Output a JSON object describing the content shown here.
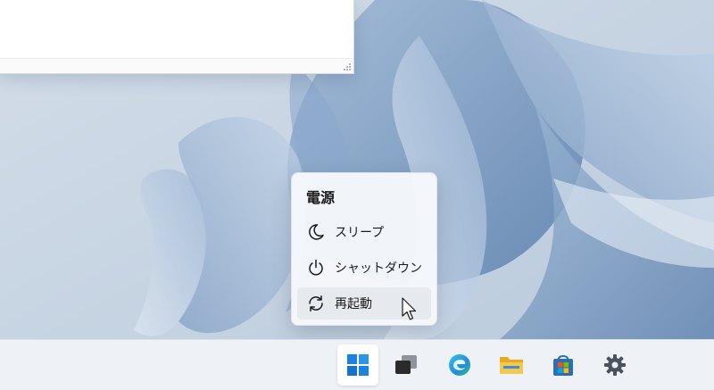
{
  "desktop": {
    "wallpaper": "windows-11-bloom-light"
  },
  "power_menu": {
    "title": "電源",
    "items": [
      {
        "label": "スリープ",
        "icon": "moon-icon"
      },
      {
        "label": "シャットダウン",
        "icon": "power-icon"
      },
      {
        "label": "再起動",
        "icon": "restart-icon"
      }
    ]
  },
  "taskbar": {
    "icons": [
      {
        "name": "windows-start-icon",
        "color": "#1a82e0"
      },
      {
        "name": "task-view-icon",
        "color": "#2b2b2b"
      },
      {
        "name": "edge-icon",
        "color": "#1f8ed8"
      },
      {
        "name": "file-explorer-icon",
        "color": "#f2c94c"
      },
      {
        "name": "microsoft-store-icon",
        "color": "#2d6fb3"
      },
      {
        "name": "settings-gear-icon",
        "color": "#4a5260"
      }
    ]
  },
  "colors": {
    "accent": "#0067c0",
    "menu_background": "#f6f8fb",
    "taskbar_background": "#eef1f5"
  }
}
